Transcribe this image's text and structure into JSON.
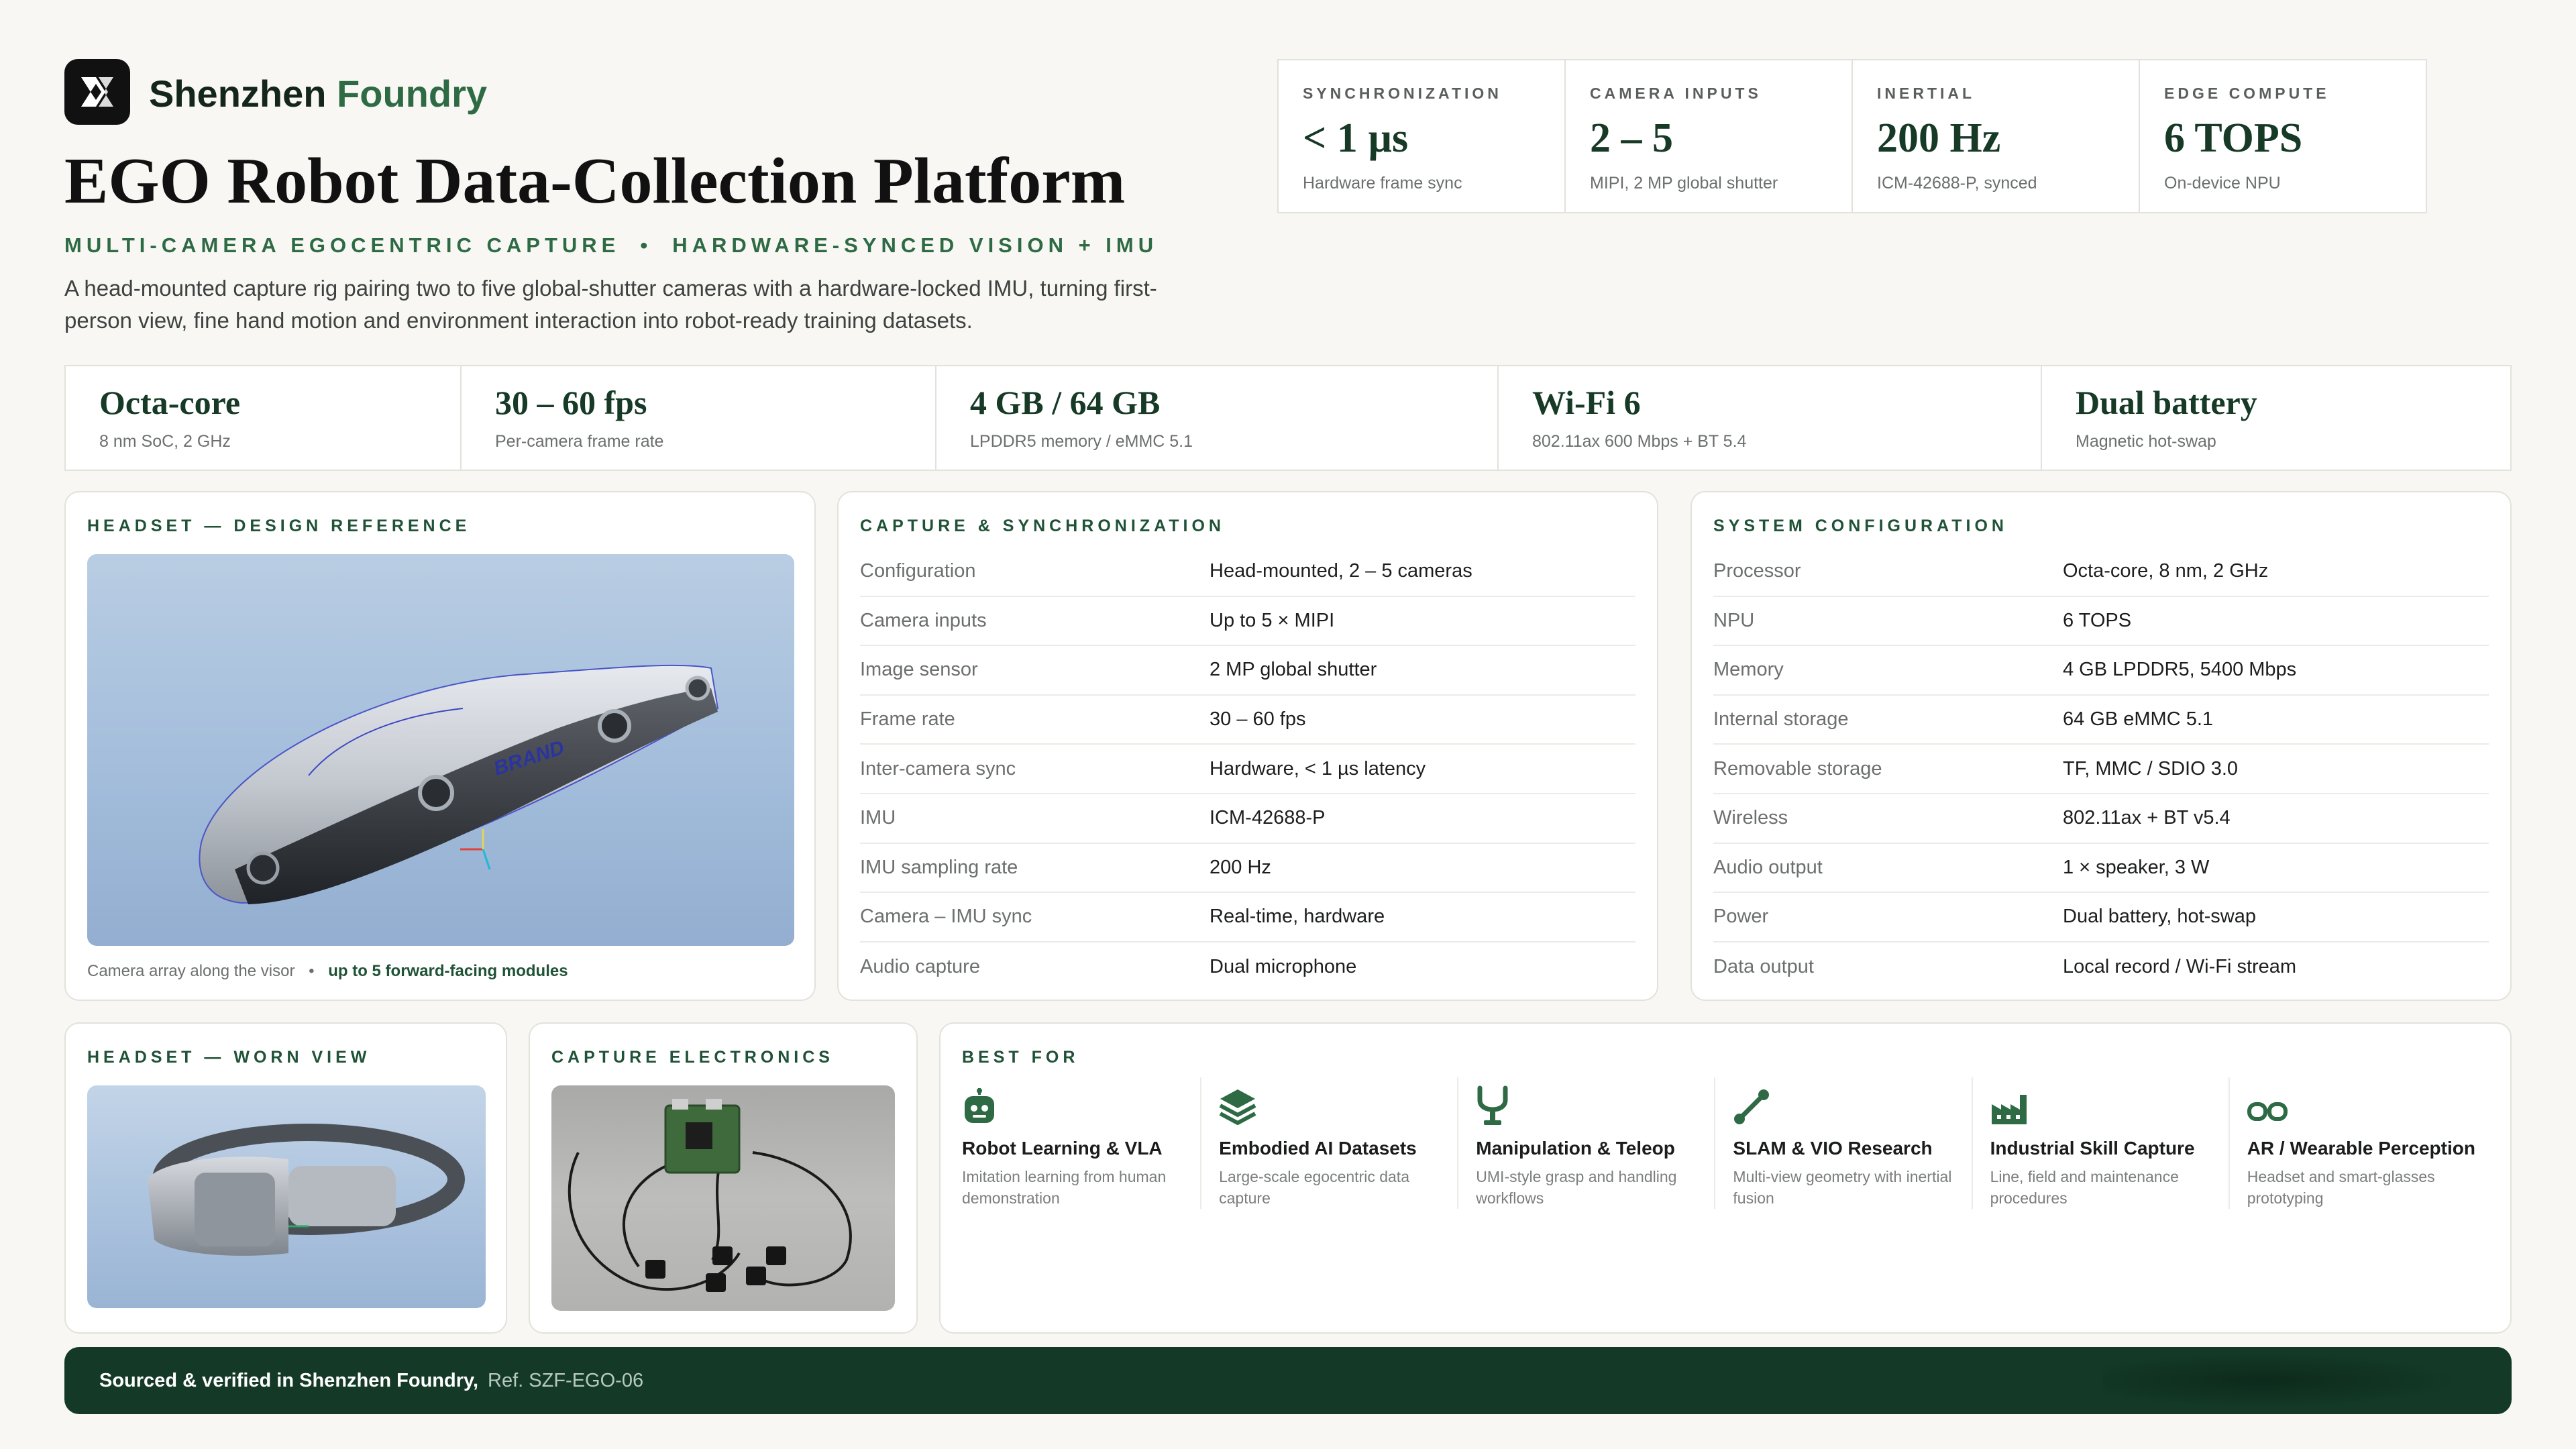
{
  "brand": {
    "name_part1": "Shenzhen",
    "name_part2": "Foundry"
  },
  "title": "EGO Robot Data-Collection Platform",
  "tagline": {
    "left": "MULTI-CAMERA EGOCENTRIC CAPTURE",
    "sep": "•",
    "right": "HARDWARE-SYNCED VISION + IMU"
  },
  "intro": "A head-mounted capture rig pairing two to five global-shutter cameras with a hardware-locked IMU, turning first-person view, fine hand motion and environment interaction into robot-ready training datasets.",
  "top_stats": [
    {
      "label": "SYNCHRONIZATION",
      "value": "< 1 µs",
      "sub": "Hardware frame sync"
    },
    {
      "label": "CAMERA INPUTS",
      "value": "2 – 5",
      "sub": "MIPI, 2 MP global shutter"
    },
    {
      "label": "INERTIAL",
      "value": "200 Hz",
      "sub": "ICM-42688-P, synced"
    },
    {
      "label": "EDGE COMPUTE",
      "value": "6 TOPS",
      "sub": "On-device NPU"
    }
  ],
  "spec_strip": [
    {
      "value": "Octa-core",
      "sub": "8 nm SoC, 2 GHz"
    },
    {
      "value": "30 – 60 fps",
      "sub": "Per-camera frame rate"
    },
    {
      "value": "4 GB / 64 GB",
      "sub": "LPDDR5 memory / eMMC 5.1"
    },
    {
      "value": "Wi-Fi 6",
      "sub": "802.11ax 600 Mbps + BT 5.4"
    },
    {
      "value": "Dual battery",
      "sub": "Magnetic hot-swap"
    }
  ],
  "design_card": {
    "label": "HEADSET — DESIGN REFERENCE",
    "render_text": "BRAND",
    "caption_plain": "Camera array along the visor",
    "caption_sep": "•",
    "caption_bold": "up to 5 forward-facing modules"
  },
  "capture_card": {
    "label": "CAPTURE & SYNCHRONIZATION",
    "rows": [
      {
        "k": "Configuration",
        "v": "Head-mounted, 2 – 5 cameras"
      },
      {
        "k": "Camera inputs",
        "v": "Up to 5 × MIPI"
      },
      {
        "k": "Image sensor",
        "v": "2 MP global shutter"
      },
      {
        "k": "Frame rate",
        "v": "30 – 60 fps"
      },
      {
        "k": "Inter-camera sync",
        "v": "Hardware, < 1 µs latency"
      },
      {
        "k": "IMU",
        "v": "ICM-42688-P"
      },
      {
        "k": "IMU sampling rate",
        "v": "200 Hz"
      },
      {
        "k": "Camera – IMU sync",
        "v": "Real-time, hardware"
      },
      {
        "k": "Audio capture",
        "v": "Dual microphone"
      }
    ]
  },
  "system_card": {
    "label": "SYSTEM CONFIGURATION",
    "rows": [
      {
        "k": "Processor",
        "v": "Octa-core, 8 nm, 2 GHz"
      },
      {
        "k": "NPU",
        "v": "6 TOPS"
      },
      {
        "k": "Memory",
        "v": "4 GB LPDDR5, 5400 Mbps"
      },
      {
        "k": "Internal storage",
        "v": "64 GB eMMC 5.1"
      },
      {
        "k": "Removable storage",
        "v": "TF, MMC / SDIO 3.0"
      },
      {
        "k": "Wireless",
        "v": "802.11ax + BT v5.4"
      },
      {
        "k": "Audio output",
        "v": "1 × speaker, 3 W"
      },
      {
        "k": "Power",
        "v": "Dual battery, hot-swap"
      },
      {
        "k": "Data output",
        "v": "Local record / Wi-Fi stream"
      }
    ]
  },
  "worn_card": {
    "label": "HEADSET — WORN VIEW"
  },
  "electronics_card": {
    "label": "CAPTURE ELECTRONICS"
  },
  "best_for": {
    "label": "BEST FOR",
    "items": [
      {
        "icon": "robot-icon",
        "title": "Robot Learning & VLA",
        "desc": "Imitation learning from human demonstration"
      },
      {
        "icon": "layers-icon",
        "title": "Embodied AI Datasets",
        "desc": "Large-scale egocentric data capture"
      },
      {
        "icon": "gripper-icon",
        "title": "Manipulation & Teleop",
        "desc": "UMI-style grasp and handling workflows"
      },
      {
        "icon": "route-icon",
        "title": "SLAM & VIO Research",
        "desc": "Multi-view geometry with inertial fusion"
      },
      {
        "icon": "factory-icon",
        "title": "Industrial Skill Capture",
        "desc": "Line, field and maintenance procedures"
      },
      {
        "icon": "glasses-icon",
        "title": "AR / Wearable Perception",
        "desc": "Headset and smart-glasses prototyping"
      }
    ]
  },
  "footer": {
    "bold": "Sourced & verified in Shenzhen Foundry,",
    "ref": "Ref. SZF-EGO-06"
  },
  "colors": {
    "accent": "#2e6b45",
    "dark_green": "#143a27",
    "background": "#f8f7f3"
  }
}
